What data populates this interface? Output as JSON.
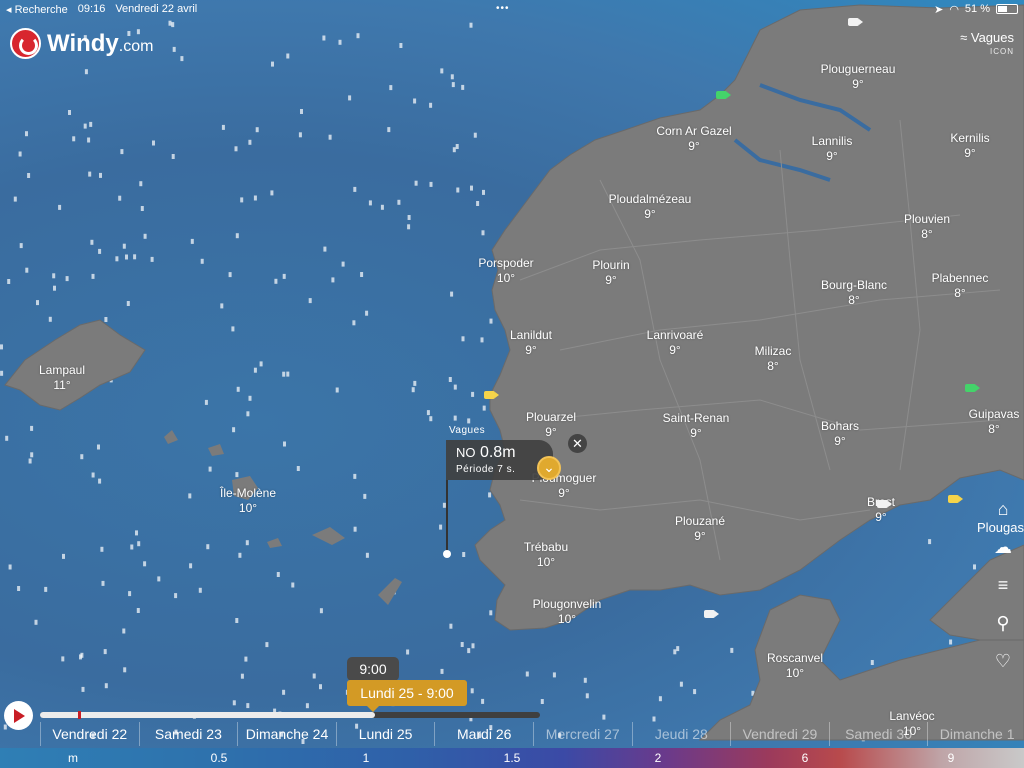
{
  "status": {
    "back_label": "◂ Recherche",
    "time": "09:16",
    "date": "Vendredi 22 avril",
    "dots": "•••",
    "battery": "51 %"
  },
  "logo": {
    "name": "Windy",
    "suffix": ".com"
  },
  "layer": {
    "name": "≈ Vagues",
    "model": "ICON"
  },
  "cities": [
    {
      "name": "Plouguerneau",
      "temp": "9°"
    },
    {
      "name": "Corn Ar Gazel",
      "temp": "9°"
    },
    {
      "name": "Lannilis",
      "temp": "9°"
    },
    {
      "name": "Kernilis",
      "temp": "9°"
    },
    {
      "name": "Ploudalmézeau",
      "temp": "9°"
    },
    {
      "name": "Plouvien",
      "temp": "8°"
    },
    {
      "name": "Porspoder",
      "temp": "10°"
    },
    {
      "name": "Plourin",
      "temp": "9°"
    },
    {
      "name": "Bourg-Blanc",
      "temp": "8°"
    },
    {
      "name": "Plabennec",
      "temp": "8°"
    },
    {
      "name": "Lampaul",
      "temp": "11°"
    },
    {
      "name": "Lanildut",
      "temp": "9°"
    },
    {
      "name": "Lanrivoaré",
      "temp": "9°"
    },
    {
      "name": "Milizac",
      "temp": "8°"
    },
    {
      "name": "Plouarzel",
      "temp": "9°"
    },
    {
      "name": "Saint-Renan",
      "temp": "9°"
    },
    {
      "name": "Bohars",
      "temp": "9°"
    },
    {
      "name": "Guipavas",
      "temp": "8°"
    },
    {
      "name": "Ploumoguer",
      "temp": "9°"
    },
    {
      "name": "Île-Molène",
      "temp": "10°"
    },
    {
      "name": "Brest",
      "temp": "9°"
    },
    {
      "name": "Plouzané",
      "temp": "9°"
    },
    {
      "name": "Trébabu",
      "temp": "10°"
    },
    {
      "name": "Plougonvelin",
      "temp": "10°"
    },
    {
      "name": "Roscanvel",
      "temp": "10°"
    },
    {
      "name": "Lanvéoc",
      "temp": "10°"
    }
  ],
  "popup": {
    "layer_label": "Vagues",
    "direction": "NO",
    "value": "0.8m",
    "period": "Période 7 s.",
    "close": "✕",
    "expand": "⌄"
  },
  "side": {
    "label": "Plougas"
  },
  "timeline": {
    "hover_time": "9:00",
    "current": "Lundi 25 - 9:00",
    "progress": 0.67,
    "days": [
      {
        "label": "Vendredi 22",
        "muted": false
      },
      {
        "label": "Samedi 23",
        "muted": false
      },
      {
        "label": "Dimanche 24",
        "muted": false
      },
      {
        "label": "Lundi 25",
        "muted": false
      },
      {
        "label": "Mardi 26",
        "muted": false
      },
      {
        "label": "Mercredi 27",
        "muted": true
      },
      {
        "label": "Jeudi 28",
        "muted": true
      },
      {
        "label": "Vendredi 29",
        "muted": true
      },
      {
        "label": "Samedi 30",
        "muted": true
      },
      {
        "label": "Dimanche 1",
        "muted": true
      }
    ]
  },
  "scale": {
    "unit": "m",
    "values": [
      "0.5",
      "1",
      "1.5",
      "2",
      "6",
      "9"
    ]
  },
  "colors": {
    "sea": "#3a6fa0",
    "land": "#7b7b7b",
    "accent": "#d39a25",
    "brand": "#d8262e"
  }
}
